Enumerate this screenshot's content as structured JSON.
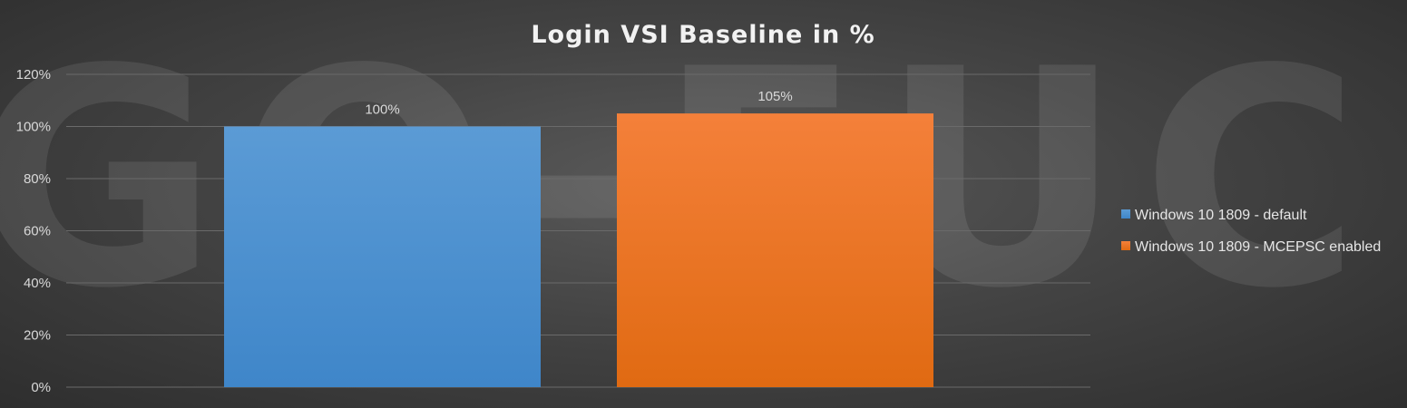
{
  "watermark": "GO-EUC",
  "colors": {
    "series_1": "#5b9bd5",
    "series_1_dark": "#3f86c9",
    "series_2": "#f4803a",
    "series_2_dark": "#e06a12",
    "gridline": "#6a6a6a"
  },
  "chart_data": {
    "type": "bar",
    "title": "Login VSI Baseline in %",
    "categories": [
      ""
    ],
    "series": [
      {
        "name": "Windows 10 1809 - default",
        "values": [
          100
        ],
        "label": "100%"
      },
      {
        "name": "Windows 10 1809 - MCEPSC enabled",
        "values": [
          105
        ],
        "label": "105%"
      }
    ],
    "ylim": [
      0,
      120
    ],
    "yticks": [
      "0%",
      "20%",
      "40%",
      "60%",
      "80%",
      "100%",
      "120%"
    ],
    "xlabel": "",
    "ylabel": "",
    "grid": true,
    "legend_position": "right"
  }
}
